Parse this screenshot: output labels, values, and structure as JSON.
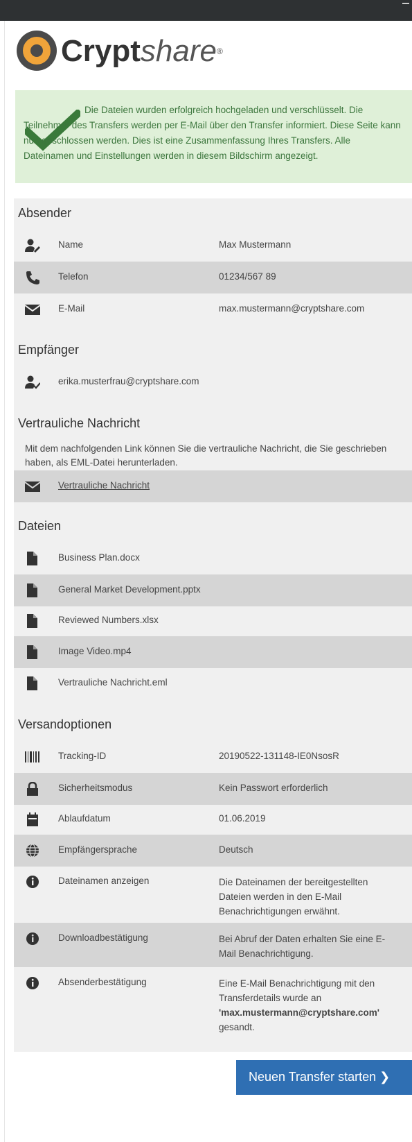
{
  "brand": {
    "name_bold": "Crypt",
    "name_light": "share",
    "mark": "®"
  },
  "alert": {
    "message": "Die Dateien wurden erfolgreich hochgeladen und verschlüsselt. Die Teilnehmer des Transfers werden per E-Mail über den Transfer informiert. Diese Seite kann nun geschlossen werden. Dies ist eine Zusammenfassung Ihres Transfers. Alle Dateinamen und Einstellungen werden in diesem Bildschirm angezeigt.",
    "icon": "check-icon",
    "color": "#3c763d"
  },
  "sender": {
    "title": "Absender",
    "rows": [
      {
        "icon": "user-edit-icon",
        "label": "Name",
        "value": "Max Mustermann"
      },
      {
        "icon": "phone-icon",
        "label": "Telefon",
        "value": "01234/567 89"
      },
      {
        "icon": "envelope-icon",
        "label": "E-Mail",
        "value": "max.mustermann@cryptshare.com"
      }
    ]
  },
  "recipients": {
    "title": "Empfänger",
    "items": [
      {
        "icon": "user-check-icon",
        "email": "erika.musterfrau@cryptshare.com"
      }
    ]
  },
  "confidential": {
    "title": "Vertrauliche Nachricht",
    "description": "Mit dem nachfolgenden Link können Sie die vertrauliche Nachricht, die Sie geschrieben haben, als EML-Datei herunterladen.",
    "link_label": "Vertrauliche Nachricht"
  },
  "files": {
    "title": "Dateien",
    "items": [
      "Business Plan.docx",
      "General Market Development.pptx",
      "Reviewed Numbers.xlsx",
      "Image Video.mp4",
      "Vertrauliche Nachricht.eml"
    ]
  },
  "options": {
    "title": "Versandoptionen",
    "rows": [
      {
        "icon": "barcode-icon",
        "label": "Tracking-ID",
        "value": "20190522-131148-IE0NsosR"
      },
      {
        "icon": "lock-icon",
        "label": "Sicherheitsmodus",
        "value": "Kein Passwort erforderlich"
      },
      {
        "icon": "calendar-icon",
        "label": "Ablaufdatum",
        "value": "01.06.2019"
      },
      {
        "icon": "globe-icon",
        "label": "Empfängersprache",
        "value": "Deutsch"
      },
      {
        "icon": "info-icon",
        "label": "Dateinamen anzeigen",
        "value": "Die Dateinamen der bereitgestellten Dateien werden in den E-Mail Benachrichtigungen erwähnt."
      },
      {
        "icon": "info-icon",
        "label": "Downloadbestätigung",
        "value": "Bei Abruf der Daten erhalten Sie eine E-Mail Benachrichtigung."
      },
      {
        "icon": "info-icon",
        "label": "Absenderbestätigung",
        "value_pre": "Eine E-Mail Benachrichtigung mit den Transferdetails wurde an",
        "value_bold": "'max.mustermann@cryptshare.com'",
        "value_post": "gesandt."
      }
    ]
  },
  "actions": {
    "new_transfer": "Neuen Transfer starten ❯"
  },
  "colors": {
    "alert_bg": "#dff0d8",
    "panel_bg": "#f0f0f0",
    "row_alt": "#d5d5d5",
    "button": "#2f6fb3"
  }
}
